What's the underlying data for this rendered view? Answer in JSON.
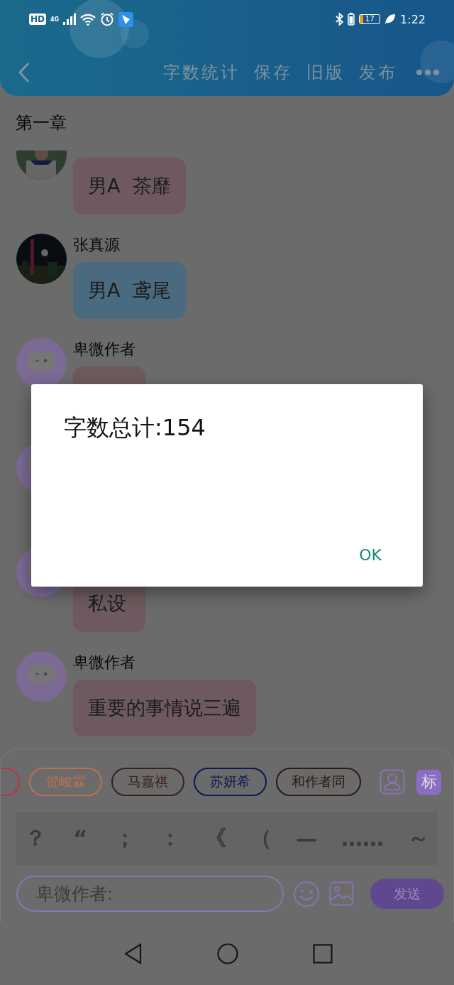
{
  "status_bar": {
    "hd": "HD",
    "network": "4G",
    "battery": "17",
    "time": "1:22"
  },
  "toolbar": {
    "actions": [
      "字数统计",
      "保存",
      "旧版",
      "发布"
    ]
  },
  "chapter_title": "第一章",
  "messages": [
    {
      "text": "男A  茶靡",
      "color": "#6e5a5e"
    },
    {
      "name": "张真源",
      "text": "男A  鸢尾",
      "color": "#4a6a80"
    },
    {
      "kind": "mascot",
      "name": "卑微作者",
      "color": "#6e5a5e"
    },
    {
      "kind": "mascot"
    },
    {
      "kind": "mascot",
      "text": "私设",
      "color": "#6e5a5e"
    },
    {
      "kind": "mascot",
      "name": "卑微作者",
      "text": "重要的事情说三遍",
      "color": "#6e5a5e"
    }
  ],
  "character_tags": [
    {
      "color": "#c0304a"
    },
    {
      "label": "贺峻霖",
      "color": "#c07050"
    },
    {
      "label": "马嘉祺",
      "color": "#3a2018"
    },
    {
      "label": "苏妍希",
      "color": "#0a1a50"
    },
    {
      "label": "和作者同",
      "color": "#2e1a10"
    }
  ],
  "tag_button": "标",
  "punctuation": [
    "？",
    "“",
    "；",
    "：",
    "《",
    "（",
    "—",
    "……",
    "～"
  ],
  "input": {
    "placeholder": "卑微作者:"
  },
  "send_button": "发送",
  "dialog": {
    "message": "字数总计:154",
    "button": "OK"
  }
}
